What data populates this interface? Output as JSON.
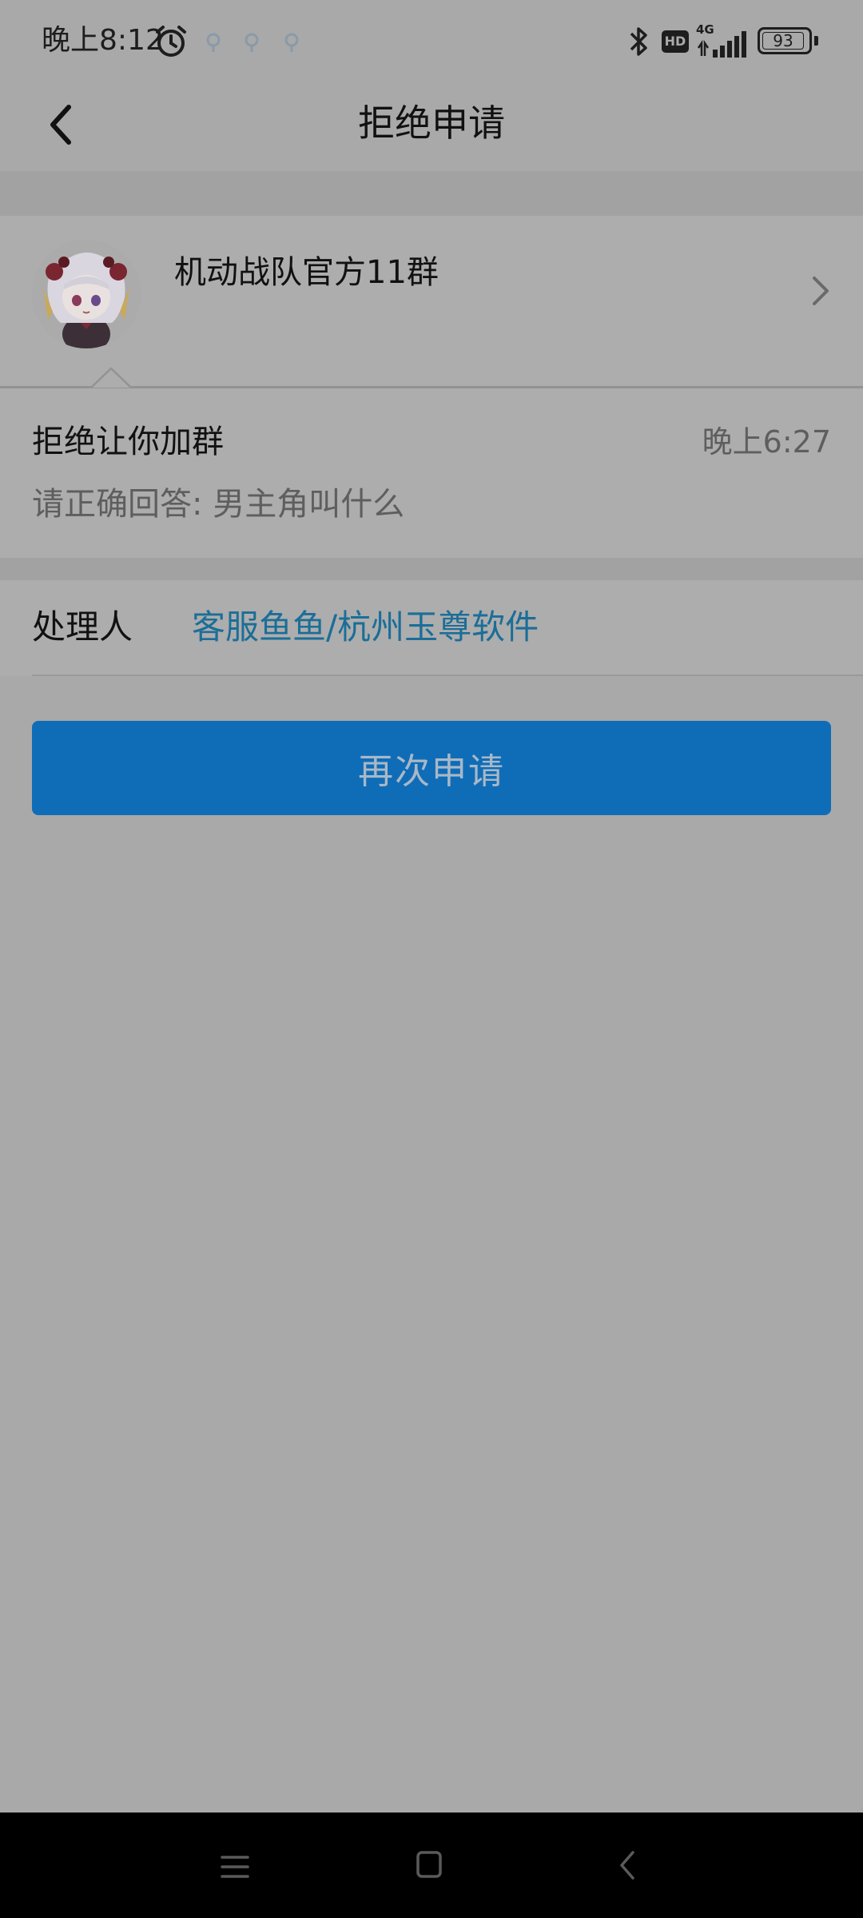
{
  "status_bar": {
    "time": "晚上8:12",
    "network": "4G",
    "hd": "HD",
    "battery": "93"
  },
  "header": {
    "title": "拒绝申请"
  },
  "group": {
    "name": "机动战队官方11群"
  },
  "message": {
    "title": "拒绝让你加群",
    "time": "晚上6:27",
    "body": "请正确回答: 男主角叫什么"
  },
  "handler": {
    "label": "处理人",
    "name": "客服鱼鱼/杭州玉尊软件"
  },
  "actions": {
    "reapply_label": "再次申请"
  },
  "colors": {
    "accent": "#0f6db8",
    "link": "#1b6e98",
    "background": "#a9a9a9"
  }
}
